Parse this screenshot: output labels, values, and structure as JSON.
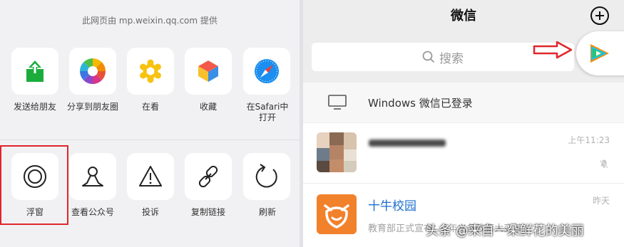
{
  "share_sheet": {
    "source_note": "此网页由 mp.weixin.qq.com 提供",
    "row1": [
      {
        "label": "发送给朋友",
        "icon": "send-to-friend-icon"
      },
      {
        "label": "分享到朋友圈",
        "icon": "moments-icon"
      },
      {
        "label": "在看",
        "icon": "wow-icon"
      },
      {
        "label": "收藏",
        "icon": "favorite-cube-icon"
      },
      {
        "label": "在Safari中\n打开",
        "icon": "safari-compass-icon"
      }
    ],
    "row2": [
      {
        "label": "浮窗",
        "icon": "float-window-icon"
      },
      {
        "label": "查看公众号",
        "icon": "official-account-icon"
      },
      {
        "label": "投诉",
        "icon": "warning-icon"
      },
      {
        "label": "复制链接",
        "icon": "link-icon"
      },
      {
        "label": "刷新",
        "icon": "refresh-icon"
      }
    ],
    "highlight_color": "#e0262a"
  },
  "wechat": {
    "title": "微信",
    "search_placeholder": "搜索",
    "windows_login": "Windows 微信已登录",
    "chats": [
      {
        "name": "",
        "time": "上午11:23",
        "preview": "",
        "muted": true
      },
      {
        "name": "十牛校园",
        "time": "昨天",
        "preview": "教育部正式宣布：9年义务教育大变革！"
      }
    ],
    "accent_green": "#07c160"
  },
  "watermark": "头条 @来自一朵鲜花的美丽"
}
